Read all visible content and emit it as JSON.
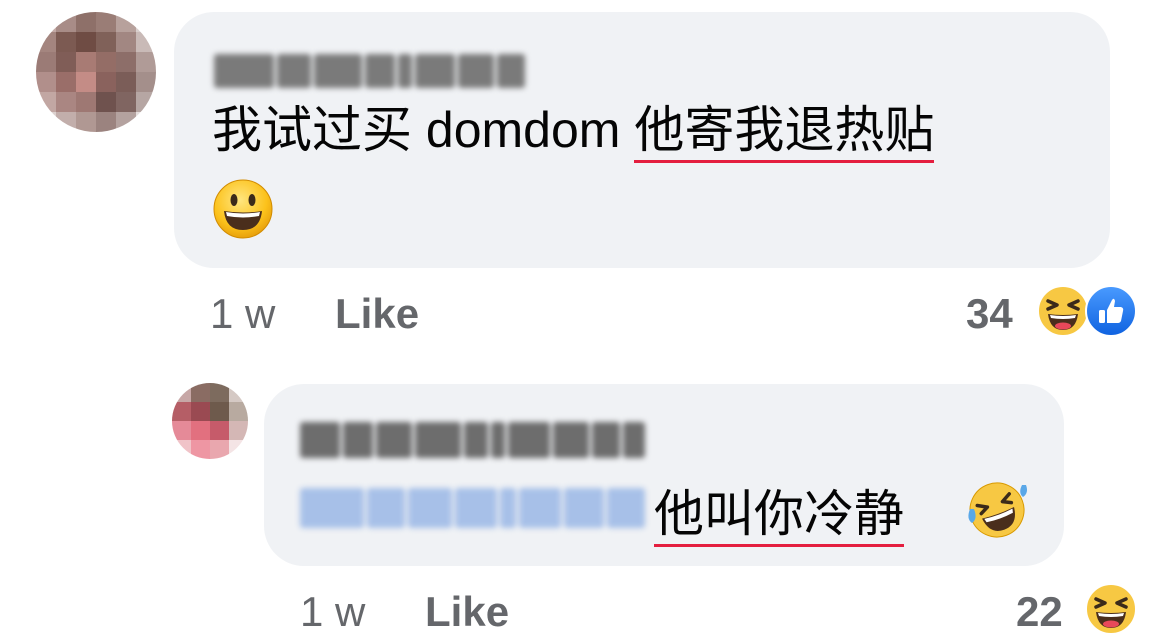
{
  "comments": [
    {
      "text": "我试过买 domdom ",
      "highlight": "他寄我退热贴",
      "time": "1 w",
      "like_label": "Like",
      "reaction_count": "34",
      "reactions": [
        "laughing-face-icon",
        "thumbs-up-icon"
      ]
    },
    {
      "highlight": "他叫你冷静",
      "time": "1 w",
      "like_label": "Like",
      "reaction_count": "22",
      "reactions": [
        "laughing-face-icon"
      ]
    }
  ],
  "colors": {
    "bubble": "#f0f2f5",
    "meta_text": "#65676b",
    "underline": "#e41e3f",
    "like_blue": "#1877f2"
  }
}
